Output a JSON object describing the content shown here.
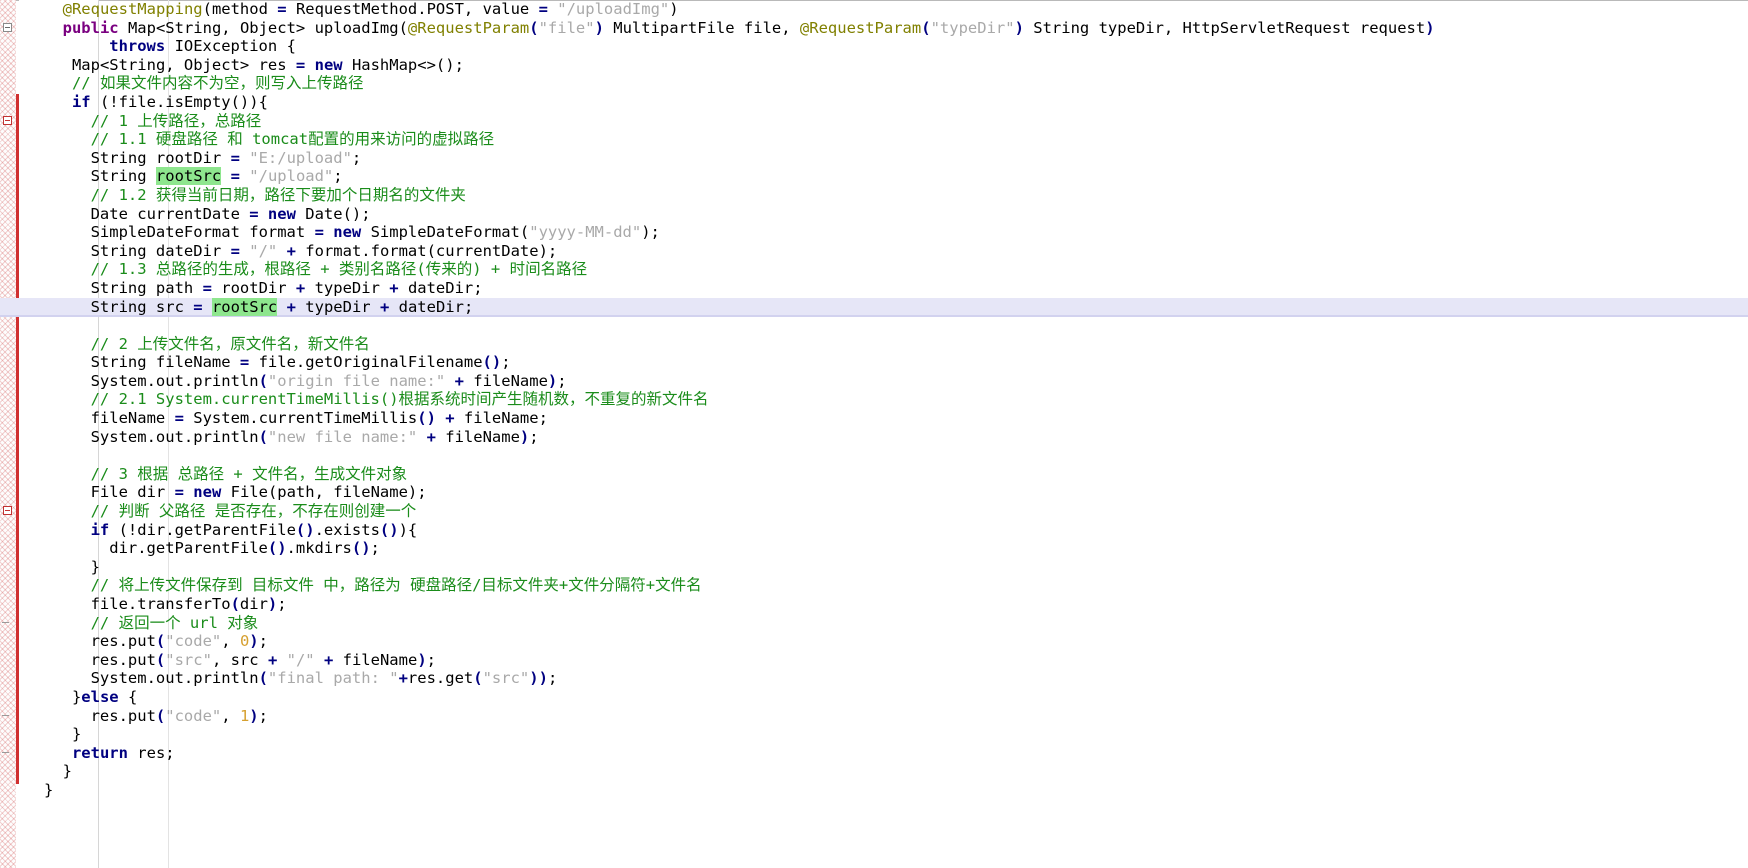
{
  "editor": {
    "language": "Java",
    "colors": {
      "keyword": "#000080",
      "modifier": "#7a0080",
      "string": "#a9a9a9",
      "comment": "#1a8c1a",
      "number": "#d6a030",
      "annotation": "#808000",
      "occurrence_highlight": "#8ee68e",
      "caret_line": "#e6e6f7",
      "change_stripe": "#d03030",
      "background": "#ffffff"
    },
    "caret_line_index": 16,
    "highlighted_identifier": "rootSrc",
    "gutter": {
      "fold_markers": [
        {
          "line_index": 1,
          "style": "minus-gray"
        },
        {
          "line_index": 6,
          "style": "minus-red"
        },
        {
          "line_index": 27,
          "style": "minus-red"
        },
        {
          "line_index": 33,
          "style": "dash"
        },
        {
          "line_index": 38,
          "style": "dash"
        },
        {
          "line_index": 40,
          "style": "dash"
        }
      ]
    },
    "lines": [
      {
        "indent": 2,
        "tokens": [
          {
            "t": "@RequestMapping",
            "c": "ann"
          },
          {
            "t": "(method ",
            "c": "plain"
          },
          {
            "t": "=",
            "c": "op"
          },
          {
            "t": " RequestMethod.POST, value ",
            "c": "plain"
          },
          {
            "t": "=",
            "c": "op"
          },
          {
            "t": " ",
            "c": "plain"
          },
          {
            "t": "\"/uploadImg\"",
            "c": "str"
          },
          {
            "t": ")",
            "c": "plain"
          }
        ]
      },
      {
        "indent": 2,
        "tokens": [
          {
            "t": "public",
            "c": "kw2"
          },
          {
            "t": " Map<String, Object> uploadImg(",
            "c": "plain"
          },
          {
            "t": "@RequestParam",
            "c": "ann"
          },
          {
            "t": "(",
            "c": "op"
          },
          {
            "t": "\"file\"",
            "c": "str"
          },
          {
            "t": ")",
            "c": "op"
          },
          {
            "t": " MultipartFile file, ",
            "c": "plain"
          },
          {
            "t": "@RequestParam",
            "c": "ann"
          },
          {
            "t": "(",
            "c": "op"
          },
          {
            "t": "\"typeDir\"",
            "c": "str"
          },
          {
            "t": ")",
            "c": "op"
          },
          {
            "t": " String typeDir, HttpServletRequest request",
            "c": "plain"
          },
          {
            "t": ")",
            "c": "op"
          }
        ]
      },
      {
        "indent": 7,
        "tokens": [
          {
            "t": "throws",
            "c": "kw"
          },
          {
            "t": " IOException ",
            "c": "plain"
          },
          {
            "t": "{",
            "c": "plain"
          }
        ]
      },
      {
        "indent": 3,
        "tokens": [
          {
            "t": "Map<String, Object> res ",
            "c": "plain"
          },
          {
            "t": "=",
            "c": "op"
          },
          {
            "t": " ",
            "c": "plain"
          },
          {
            "t": "new",
            "c": "kw"
          },
          {
            "t": " HashMap<>();",
            "c": "plain"
          }
        ]
      },
      {
        "indent": 3,
        "tokens": [
          {
            "t": "// 如果文件内容不为空，则写入上传路径",
            "c": "cmt"
          }
        ]
      },
      {
        "indent": 3,
        "tokens": [
          {
            "t": "if",
            "c": "kw"
          },
          {
            "t": " (!file.isEmpty()){",
            "c": "plain"
          }
        ]
      },
      {
        "indent": 5,
        "tokens": [
          {
            "t": "// 1 上传路径，总路径",
            "c": "cmt"
          }
        ]
      },
      {
        "indent": 5,
        "tokens": [
          {
            "t": "// 1.1 硬盘路径 和 tomcat配置的用来访问的虚拟路径",
            "c": "cmt"
          }
        ]
      },
      {
        "indent": 5,
        "tokens": [
          {
            "t": "String rootDir ",
            "c": "plain"
          },
          {
            "t": "=",
            "c": "op"
          },
          {
            "t": " ",
            "c": "plain"
          },
          {
            "t": "\"E:/upload\"",
            "c": "str"
          },
          {
            "t": ";",
            "c": "plain"
          }
        ]
      },
      {
        "indent": 5,
        "tokens": [
          {
            "t": "String ",
            "c": "plain"
          },
          {
            "t": "rootSrc",
            "c": "plain",
            "hl": true
          },
          {
            "t": " ",
            "c": "plain"
          },
          {
            "t": "=",
            "c": "op"
          },
          {
            "t": " ",
            "c": "plain"
          },
          {
            "t": "\"/upload\"",
            "c": "str"
          },
          {
            "t": ";",
            "c": "plain"
          }
        ]
      },
      {
        "indent": 5,
        "tokens": [
          {
            "t": "// 1.2 获得当前日期，路径下要加个日期名的文件夹",
            "c": "cmt"
          }
        ]
      },
      {
        "indent": 5,
        "tokens": [
          {
            "t": "Date currentDate ",
            "c": "plain"
          },
          {
            "t": "=",
            "c": "op"
          },
          {
            "t": " ",
            "c": "plain"
          },
          {
            "t": "new",
            "c": "kw"
          },
          {
            "t": " Date();",
            "c": "plain"
          }
        ]
      },
      {
        "indent": 5,
        "tokens": [
          {
            "t": "SimpleDateFormat format ",
            "c": "plain"
          },
          {
            "t": "=",
            "c": "op"
          },
          {
            "t": " ",
            "c": "plain"
          },
          {
            "t": "new",
            "c": "kw"
          },
          {
            "t": " SimpleDateFormat(",
            "c": "plain"
          },
          {
            "t": "\"yyyy-MM-dd\"",
            "c": "str"
          },
          {
            "t": ");",
            "c": "plain"
          }
        ]
      },
      {
        "indent": 5,
        "tokens": [
          {
            "t": "String dateDir ",
            "c": "plain"
          },
          {
            "t": "=",
            "c": "op"
          },
          {
            "t": " ",
            "c": "plain"
          },
          {
            "t": "\"/\"",
            "c": "str"
          },
          {
            "t": " ",
            "c": "plain"
          },
          {
            "t": "+",
            "c": "op"
          },
          {
            "t": " format.format(currentDate);",
            "c": "plain"
          }
        ]
      },
      {
        "indent": 5,
        "tokens": [
          {
            "t": "// 1.3 总路径的生成，根路径 + 类别名路径(传来的) + 时间名路径",
            "c": "cmt"
          }
        ]
      },
      {
        "indent": 5,
        "tokens": [
          {
            "t": "String path ",
            "c": "plain"
          },
          {
            "t": "=",
            "c": "op"
          },
          {
            "t": " rootDir ",
            "c": "plain"
          },
          {
            "t": "+",
            "c": "op"
          },
          {
            "t": " typeDir ",
            "c": "plain"
          },
          {
            "t": "+",
            "c": "op"
          },
          {
            "t": " dateDir;",
            "c": "plain"
          }
        ]
      },
      {
        "indent": 5,
        "caret": true,
        "tokens": [
          {
            "t": "String src ",
            "c": "plain"
          },
          {
            "t": "=",
            "c": "op"
          },
          {
            "t": " ",
            "c": "plain"
          },
          {
            "t": "rootSrc",
            "c": "plain",
            "hl": true
          },
          {
            "t": " ",
            "c": "plain"
          },
          {
            "t": "+",
            "c": "op"
          },
          {
            "t": " typeDir ",
            "c": "plain"
          },
          {
            "t": "+",
            "c": "op"
          },
          {
            "t": " dateDir;",
            "c": "plain"
          }
        ]
      },
      {
        "indent": 0,
        "tokens": []
      },
      {
        "indent": 5,
        "tokens": [
          {
            "t": "// 2 上传文件名，原文件名，新文件名",
            "c": "cmt"
          }
        ]
      },
      {
        "indent": 5,
        "tokens": [
          {
            "t": "String fileName ",
            "c": "plain"
          },
          {
            "t": "=",
            "c": "op"
          },
          {
            "t": " file.getOriginalFilename",
            "c": "plain"
          },
          {
            "t": "()",
            "c": "op"
          },
          {
            "t": ";",
            "c": "plain"
          }
        ]
      },
      {
        "indent": 5,
        "tokens": [
          {
            "t": "System.out.println",
            "c": "plain"
          },
          {
            "t": "(",
            "c": "op"
          },
          {
            "t": "\"origin file name:\"",
            "c": "str"
          },
          {
            "t": " ",
            "c": "plain"
          },
          {
            "t": "+",
            "c": "op"
          },
          {
            "t": " fileName",
            "c": "plain"
          },
          {
            "t": ")",
            "c": "op"
          },
          {
            "t": ";",
            "c": "plain"
          }
        ]
      },
      {
        "indent": 5,
        "tokens": [
          {
            "t": "// 2.1 System.currentTimeMillis()根据系统时间产生随机数，不重复的新文件名",
            "c": "cmt"
          }
        ]
      },
      {
        "indent": 5,
        "tokens": [
          {
            "t": "fileName ",
            "c": "plain"
          },
          {
            "t": "=",
            "c": "op"
          },
          {
            "t": " System.currentTimeMillis",
            "c": "plain"
          },
          {
            "t": "()",
            "c": "op"
          },
          {
            "t": " ",
            "c": "plain"
          },
          {
            "t": "+",
            "c": "op"
          },
          {
            "t": " fileName;",
            "c": "plain"
          }
        ]
      },
      {
        "indent": 5,
        "tokens": [
          {
            "t": "System.out.println",
            "c": "plain"
          },
          {
            "t": "(",
            "c": "op"
          },
          {
            "t": "\"new file name:\"",
            "c": "str"
          },
          {
            "t": " ",
            "c": "plain"
          },
          {
            "t": "+",
            "c": "op"
          },
          {
            "t": " fileName",
            "c": "plain"
          },
          {
            "t": ")",
            "c": "op"
          },
          {
            "t": ";",
            "c": "plain"
          }
        ]
      },
      {
        "indent": 0,
        "tokens": []
      },
      {
        "indent": 5,
        "tokens": [
          {
            "t": "// 3 根据 总路径 + 文件名，生成文件对象",
            "c": "cmt"
          }
        ]
      },
      {
        "indent": 5,
        "tokens": [
          {
            "t": "File dir ",
            "c": "plain"
          },
          {
            "t": "=",
            "c": "op"
          },
          {
            "t": " ",
            "c": "plain"
          },
          {
            "t": "new",
            "c": "kw"
          },
          {
            "t": " File(path, fileName);",
            "c": "plain"
          }
        ]
      },
      {
        "indent": 5,
        "tokens": [
          {
            "t": "// 判断 父路径 是否存在，不存在则创建一个",
            "c": "cmt"
          }
        ]
      },
      {
        "indent": 5,
        "tokens": [
          {
            "t": "if",
            "c": "kw"
          },
          {
            "t": " (!dir.getParentFile",
            "c": "plain"
          },
          {
            "t": "()",
            "c": "op"
          },
          {
            "t": ".exists",
            "c": "plain"
          },
          {
            "t": "()",
            "c": "op"
          },
          {
            "t": "){",
            "c": "plain"
          }
        ]
      },
      {
        "indent": 7,
        "tokens": [
          {
            "t": "dir.getParentFile",
            "c": "plain"
          },
          {
            "t": "()",
            "c": "op"
          },
          {
            "t": ".mkdirs",
            "c": "plain"
          },
          {
            "t": "()",
            "c": "op"
          },
          {
            "t": ";",
            "c": "plain"
          }
        ]
      },
      {
        "indent": 5,
        "tokens": [
          {
            "t": "}",
            "c": "plain"
          }
        ]
      },
      {
        "indent": 5,
        "tokens": [
          {
            "t": "// 将上传文件保存到 目标文件 中，路径为 硬盘路径/目标文件夹+文件分隔符+文件名",
            "c": "cmt"
          }
        ]
      },
      {
        "indent": 5,
        "tokens": [
          {
            "t": "file.transferTo",
            "c": "plain"
          },
          {
            "t": "(",
            "c": "op"
          },
          {
            "t": "dir",
            "c": "plain"
          },
          {
            "t": ")",
            "c": "op"
          },
          {
            "t": ";",
            "c": "plain"
          }
        ]
      },
      {
        "indent": 5,
        "tokens": [
          {
            "t": "// 返回一个 url 对象",
            "c": "cmt"
          }
        ]
      },
      {
        "indent": 5,
        "tokens": [
          {
            "t": "res.put",
            "c": "plain"
          },
          {
            "t": "(",
            "c": "op"
          },
          {
            "t": "\"code\"",
            "c": "str"
          },
          {
            "t": ", ",
            "c": "plain"
          },
          {
            "t": "0",
            "c": "num"
          },
          {
            "t": ")",
            "c": "op"
          },
          {
            "t": ";",
            "c": "plain"
          }
        ]
      },
      {
        "indent": 5,
        "tokens": [
          {
            "t": "res.put",
            "c": "plain"
          },
          {
            "t": "(",
            "c": "op"
          },
          {
            "t": "\"src\"",
            "c": "str"
          },
          {
            "t": ", src ",
            "c": "plain"
          },
          {
            "t": "+",
            "c": "op"
          },
          {
            "t": " ",
            "c": "plain"
          },
          {
            "t": "\"/\"",
            "c": "str"
          },
          {
            "t": " ",
            "c": "plain"
          },
          {
            "t": "+",
            "c": "op"
          },
          {
            "t": " fileName",
            "c": "plain"
          },
          {
            "t": ")",
            "c": "op"
          },
          {
            "t": ";",
            "c": "plain"
          }
        ]
      },
      {
        "indent": 5,
        "tokens": [
          {
            "t": "System.out.println",
            "c": "plain"
          },
          {
            "t": "(",
            "c": "op"
          },
          {
            "t": "\"final path: \"",
            "c": "str"
          },
          {
            "t": "+",
            "c": "op"
          },
          {
            "t": "res.get",
            "c": "plain"
          },
          {
            "t": "(",
            "c": "op"
          },
          {
            "t": "\"src\"",
            "c": "str"
          },
          {
            "t": "))",
            "c": "op"
          },
          {
            "t": ";",
            "c": "plain"
          }
        ]
      },
      {
        "indent": 3,
        "tokens": [
          {
            "t": "}",
            "c": "plain"
          },
          {
            "t": "else",
            "c": "kw"
          },
          {
            "t": " {",
            "c": "plain"
          }
        ]
      },
      {
        "indent": 5,
        "tokens": [
          {
            "t": "res.put",
            "c": "plain"
          },
          {
            "t": "(",
            "c": "op"
          },
          {
            "t": "\"code\"",
            "c": "str"
          },
          {
            "t": ", ",
            "c": "plain"
          },
          {
            "t": "1",
            "c": "num"
          },
          {
            "t": ")",
            "c": "op"
          },
          {
            "t": ";",
            "c": "plain"
          }
        ]
      },
      {
        "indent": 3,
        "tokens": [
          {
            "t": "}",
            "c": "plain"
          }
        ]
      },
      {
        "indent": 3,
        "tokens": [
          {
            "t": "return",
            "c": "kw"
          },
          {
            "t": " res;",
            "c": "plain"
          }
        ]
      },
      {
        "indent": 2,
        "tokens": [
          {
            "t": "}",
            "c": "plain"
          }
        ]
      },
      {
        "indent": 0,
        "tokens": [
          {
            "t": "}",
            "c": "plain"
          }
        ]
      }
    ]
  }
}
